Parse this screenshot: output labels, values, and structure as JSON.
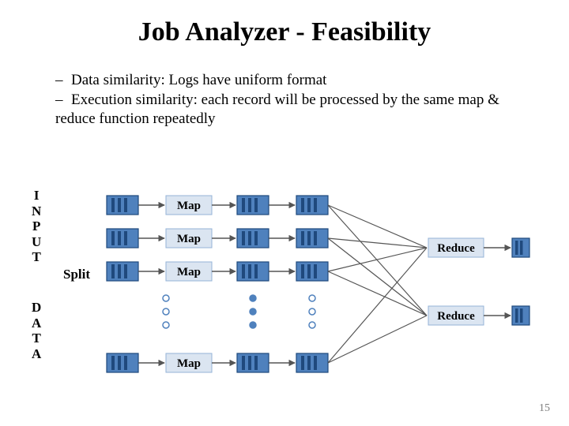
{
  "title": "Job Analyzer - Feasibility",
  "bullets": [
    "Data similarity: Logs have uniform format",
    "Execution similarity: each record will be processed by the same map & reduce function repeatedly"
  ],
  "labels": {
    "input": "I\nN\nP\nU\nT",
    "data": "D\nA\nT\nA",
    "split": "Split",
    "map": "Map",
    "reduce": "Reduce"
  },
  "page": "15",
  "colors": {
    "blockStroke": "#1f497d",
    "blockFill": "#4f81bd",
    "barFill": "#1f497d",
    "labelFill": "#dbe5f1",
    "labelStroke": "#95b3d7",
    "arrow": "#555555"
  }
}
